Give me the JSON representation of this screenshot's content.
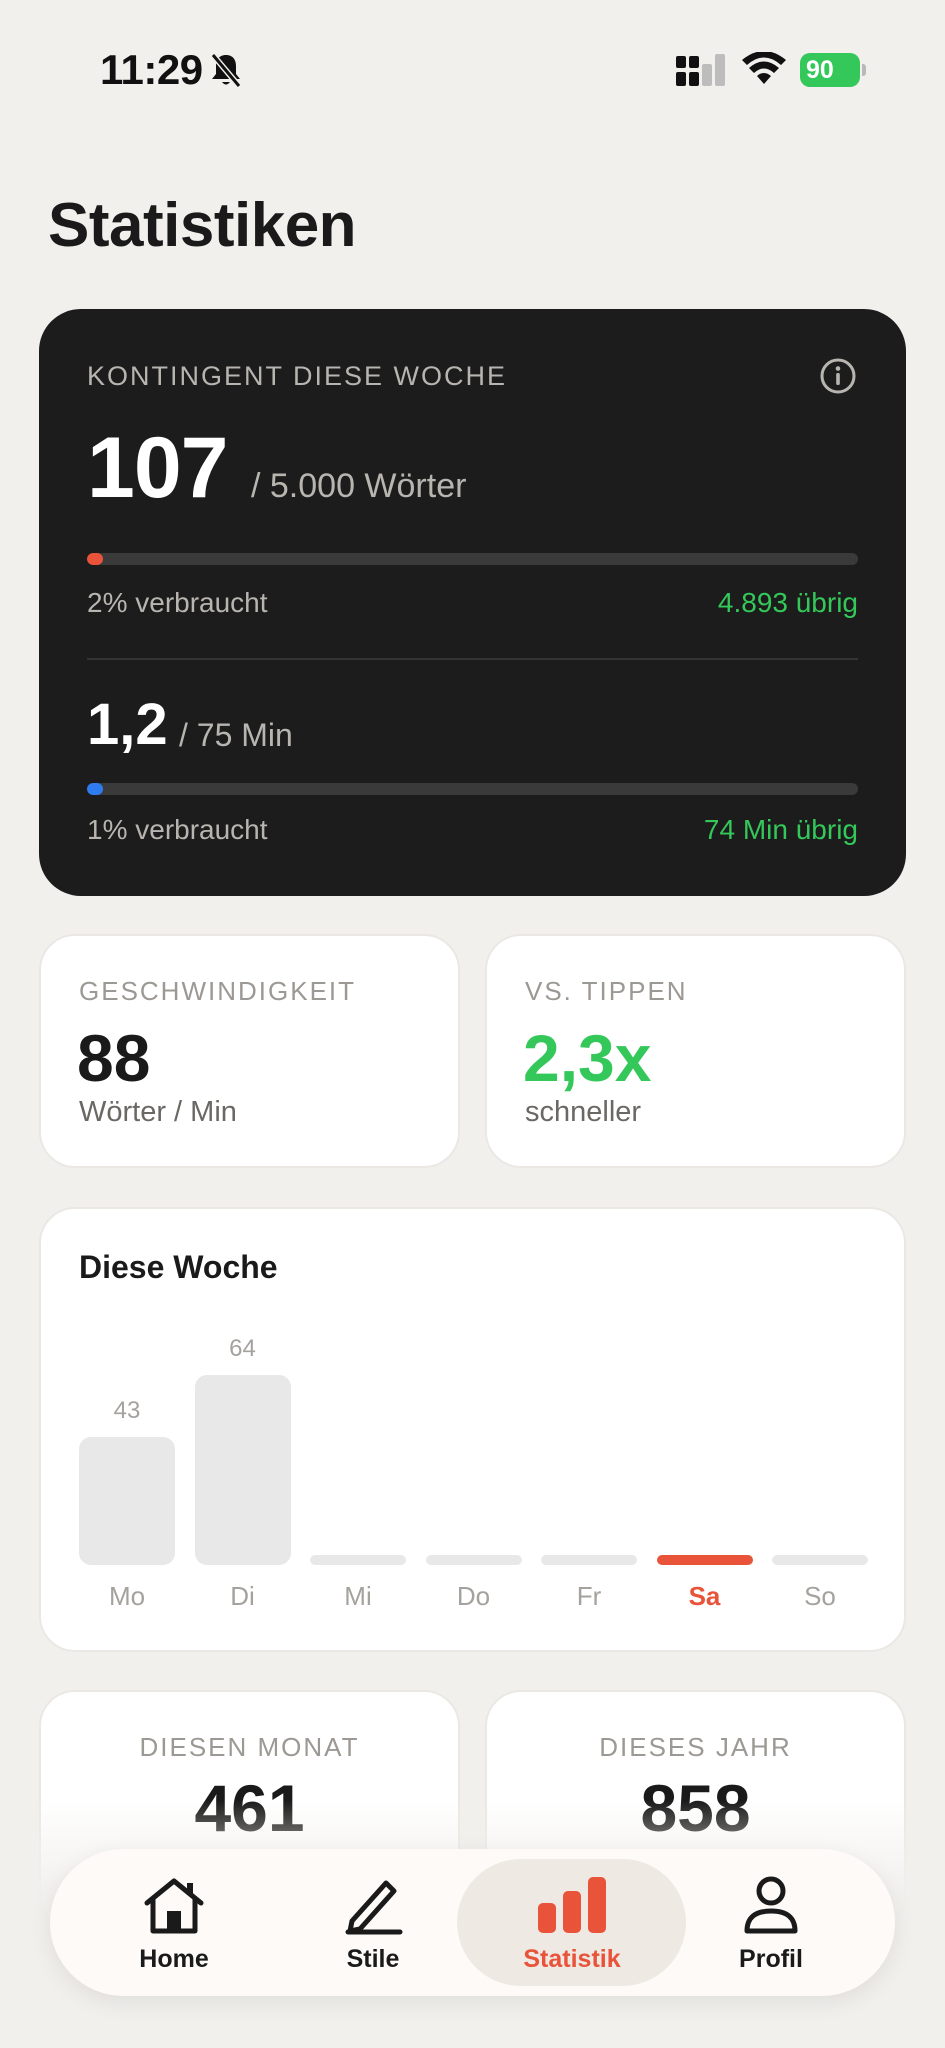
{
  "status_bar": {
    "time": "11:29",
    "battery": "90",
    "colors": {
      "battery": "#34c759"
    }
  },
  "page": {
    "title": "Statistiken"
  },
  "quota": {
    "label": "KONTINGENT DIESE WOCHE",
    "words_used": "107",
    "words_total": "/ 5.000 Wörter",
    "words_used_fraction": 0.02,
    "words_used_text": "2% verbraucht",
    "words_left_text": "4.893 übrig",
    "minutes_used": "1,2",
    "minutes_total": "/ 75 Min",
    "minutes_used_fraction": 0.01,
    "minutes_used_text": "1% verbraucht",
    "minutes_left_text": "74 Min übrig",
    "colors": {
      "card": "#1c1c1c",
      "words_bar": "#e8533a",
      "minutes_bar": "#2f7bf0",
      "remaining": "#34c759"
    }
  },
  "speed": {
    "label": "GESCHWINDIGKEIT",
    "value": "88",
    "sub": "Wörter / Min"
  },
  "vs_typing": {
    "label": "VS. TIPPEN",
    "value": "2,3x",
    "sub": "schneller"
  },
  "chart_data": {
    "type": "bar",
    "title": "Diese Woche",
    "categories": [
      "Mo",
      "Di",
      "Mi",
      "Do",
      "Fr",
      "Sa",
      "So"
    ],
    "values": [
      43,
      64,
      0,
      0,
      0,
      0,
      0
    ],
    "value_labels": [
      "43",
      "64",
      "",
      "",
      "",
      "",
      ""
    ],
    "highlight": "Sa",
    "colors": {
      "bar": "#e8e8e8",
      "today": "#e8533a"
    }
  },
  "totals": {
    "month": {
      "label": "DIESEN MONAT",
      "value": "461"
    },
    "year": {
      "label": "DIESES JAHR",
      "value": "858"
    }
  },
  "tab_bar": {
    "active": "Statistik",
    "items": [
      {
        "label": "Home",
        "icon": "home-icon"
      },
      {
        "label": "Stile",
        "icon": "pen-icon"
      },
      {
        "label": "Statistik",
        "icon": "bar-chart-icon"
      },
      {
        "label": "Profil",
        "icon": "person-icon"
      }
    ]
  }
}
